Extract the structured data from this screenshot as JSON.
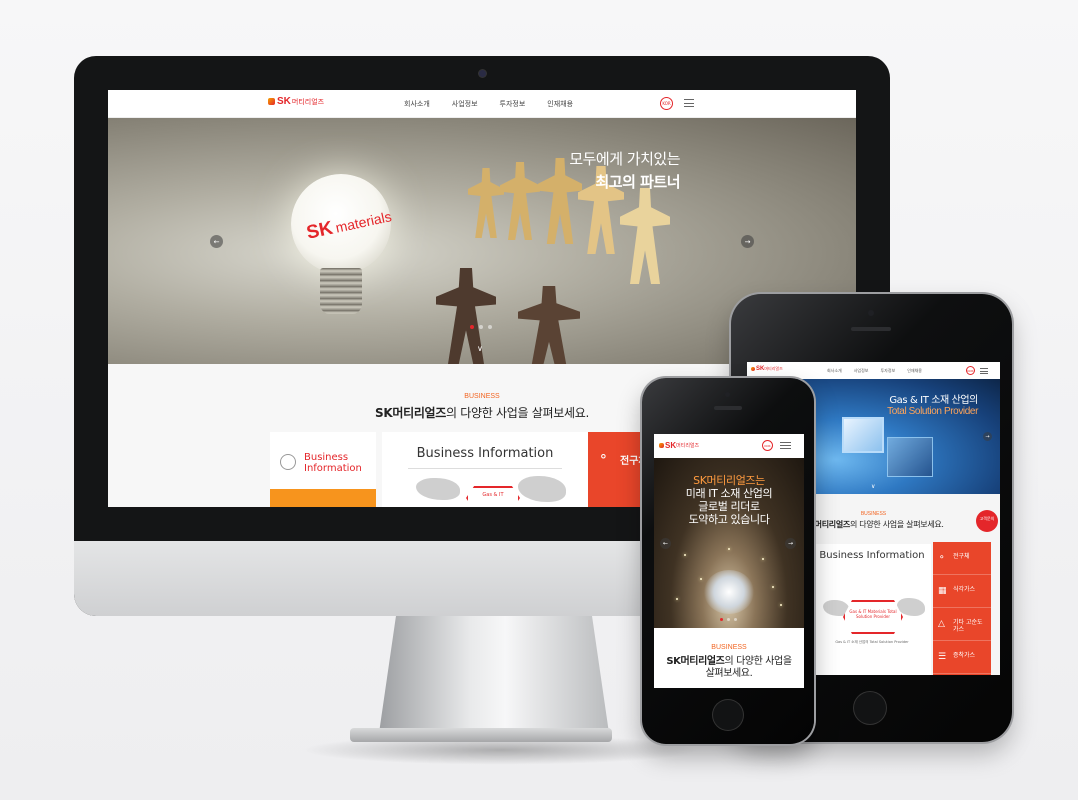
{
  "brand": {
    "sk": "SK",
    "name_kr": "머티리얼즈",
    "materials": "materials",
    "lang": "KOR"
  },
  "desktop": {
    "nav": [
      "회사소개",
      "사업정보",
      "투자정보",
      "인재채용"
    ],
    "hero": {
      "line1": "모두에게 가치있는",
      "line2": "최고의 파트너"
    },
    "business": {
      "tag": "BUSINESS",
      "title_bold": "SK머티리얼즈",
      "title_rest": "의 다양한 사업을 살펴보세요.",
      "card_left_label": "Business Information",
      "card_mid_title": "Business Information",
      "card_mid_badge": "Gas & IT",
      "card_right_label": "전구체"
    }
  },
  "tablet": {
    "nav": [
      "회사소개",
      "사업정보",
      "투자정보",
      "인재채용"
    ],
    "hero": {
      "line1": "Gas & IT 소재 산업의",
      "line2": "Total Solution Provider"
    },
    "business": {
      "tag": "BUSINESS",
      "title_bold": "SK머티리얼즈",
      "title_rest": "의 다양한 사업을 살펴보세요.",
      "mid_title": "Business Information",
      "hex": "Gas & IT Materials Total Solution Provider",
      "caption_title": "Gas & IT 소재 산업의 Total Solution Provider",
      "menu": [
        "전구체",
        "식각가스",
        "기타 고순도가스",
        "증착가스"
      ],
      "floating": "고객문의"
    }
  },
  "phone": {
    "hero": {
      "line1_hl": "SK머티리얼즈는",
      "line2": "미래 IT 소재 산업의",
      "line3": "글로벌 리더로",
      "line4": "도약하고 있습니다"
    },
    "business": {
      "tag": "BUSINESS",
      "title_bold": "SK머티리얼즈",
      "title_rest": "의 다양한 사업을",
      "title_line2": "살펴보세요."
    }
  },
  "icons": {
    "prev": "chevron-left-icon",
    "next": "chevron-right-icon",
    "menu": "hamburger-icon",
    "globe": "globe-icon",
    "molecule": "molecule-icon"
  },
  "colors": {
    "brand_red": "#e4262a",
    "brand_orange": "#f26522",
    "card_orange": "#f7941d",
    "card_red": "#e9462a"
  }
}
